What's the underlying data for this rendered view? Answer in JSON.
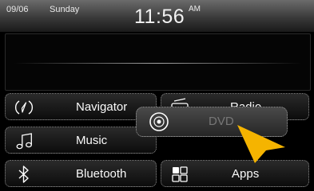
{
  "status_bar": {
    "date": "09/06",
    "day": "Sunday",
    "time": "11:56",
    "period": "AM"
  },
  "menu": {
    "navigator": "Navigator",
    "radio": "Radio",
    "music": "Music",
    "bluetooth": "Bluetooth",
    "apps": "Apps"
  },
  "drag_popup": {
    "label": "DVD"
  },
  "colors": {
    "cursor": "#f5b400",
    "popup_label": "#777777"
  }
}
